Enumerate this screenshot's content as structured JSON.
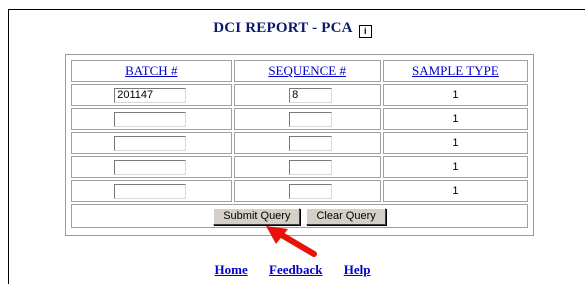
{
  "page": {
    "title": "DCI REPORT - PCA",
    "info_icon_glyph": "i"
  },
  "table": {
    "headers": [
      "BATCH #",
      "SEQUENCE #",
      "SAMPLE TYPE"
    ],
    "rows": [
      {
        "batch": "201147",
        "sequence": "8",
        "sample_type": "1"
      },
      {
        "batch": "",
        "sequence": "",
        "sample_type": "1"
      },
      {
        "batch": "",
        "sequence": "",
        "sample_type": "1"
      },
      {
        "batch": "",
        "sequence": "",
        "sample_type": "1"
      },
      {
        "batch": "",
        "sequence": "",
        "sample_type": "1"
      }
    ]
  },
  "buttons": {
    "submit": "Submit Query",
    "clear": "Clear Query"
  },
  "footer_links": [
    "Home",
    "Feedback",
    "Help"
  ],
  "colors": {
    "title": "#0c1a6e",
    "link": "#0000cc",
    "arrow": "#e8120c",
    "button_face": "#d4d0c8"
  },
  "icons": {
    "info": "info-icon",
    "annotation": "red-arrow-icon"
  }
}
